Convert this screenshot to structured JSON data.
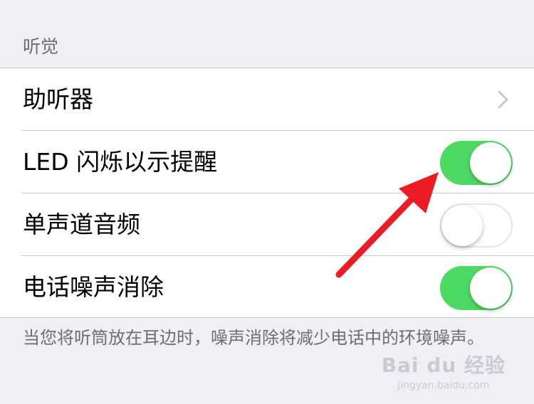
{
  "section": {
    "header": "听觉"
  },
  "rows": [
    {
      "label": "助听器",
      "control": "disclosure",
      "icon": "chevron-right-icon"
    },
    {
      "label": "LED 闪烁以示提醒",
      "control": "toggle",
      "on": true
    },
    {
      "label": "单声道音频",
      "control": "toggle",
      "on": false
    },
    {
      "label": "电话噪声消除",
      "control": "toggle",
      "on": true
    }
  ],
  "footer": {
    "note": "当您将听筒放在耳边时，噪声消除将减少电话中的环境噪声。"
  },
  "annotation": {
    "type": "arrow",
    "color": "#ec1c24",
    "points_to": "LED 闪烁以示提醒 toggle"
  },
  "watermark": {
    "logo": "Bai du 经验",
    "url": "jingyan.baidu.com"
  },
  "colors": {
    "background": "#efeff4",
    "toggle_on": "#4cd964",
    "separator": "#c8c7cc",
    "secondary_text": "#6d6d72"
  }
}
